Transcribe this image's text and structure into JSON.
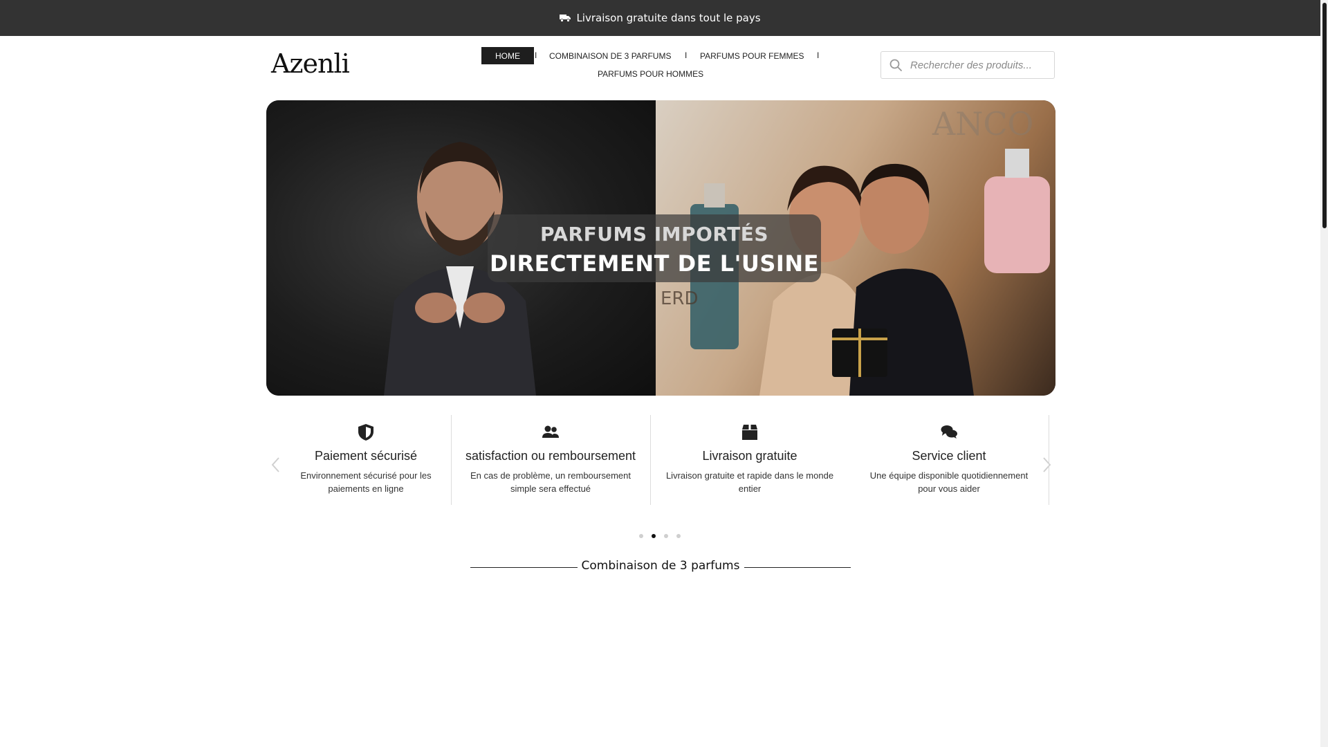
{
  "topbar": {
    "text": "Livraison gratuite dans tout le pays",
    "icon": "truck-icon"
  },
  "header": {
    "logo": "Azenli",
    "nav": {
      "home": "HOME",
      "combinaison": "COMBINAISON DE 3 PARFUMS",
      "femmes": "PARFUMS POUR FEMMES",
      "hommes": "PARFUMS POUR HOMMES",
      "separator": "I"
    },
    "search": {
      "placeholder": "Rechercher des produits...",
      "icon": "search-icon"
    }
  },
  "hero": {
    "line1": "PARFUMS IMPORTÉS",
    "line2": "DIRECTEMENT DE L'USINE",
    "bottle_text_top": "ANCO",
    "bottle_text_mid": "ERD"
  },
  "features": [
    {
      "icon": "shield-icon",
      "title": "Paiement sécurisé",
      "desc": "Environnement sécurisé pour les paiements en ligne"
    },
    {
      "icon": "users-icon",
      "title": "satisfaction ou remboursement",
      "desc": "En cas de problème, un remboursement simple sera effectué"
    },
    {
      "icon": "box-icon",
      "title": "Livraison gratuite",
      "desc": "Livraison gratuite et rapide dans le monde entier"
    },
    {
      "icon": "chat-icon",
      "title": "Service client",
      "desc": "Une équipe disponible quotidiennement pour vous aider"
    }
  ],
  "carousel": {
    "active_dot": 2,
    "dot_count": 4
  },
  "section": {
    "title": "Combinaison de 3 parfums"
  },
  "colors": {
    "topbar": "#333333",
    "accent": "#1e1e1e",
    "text": "#222222"
  }
}
